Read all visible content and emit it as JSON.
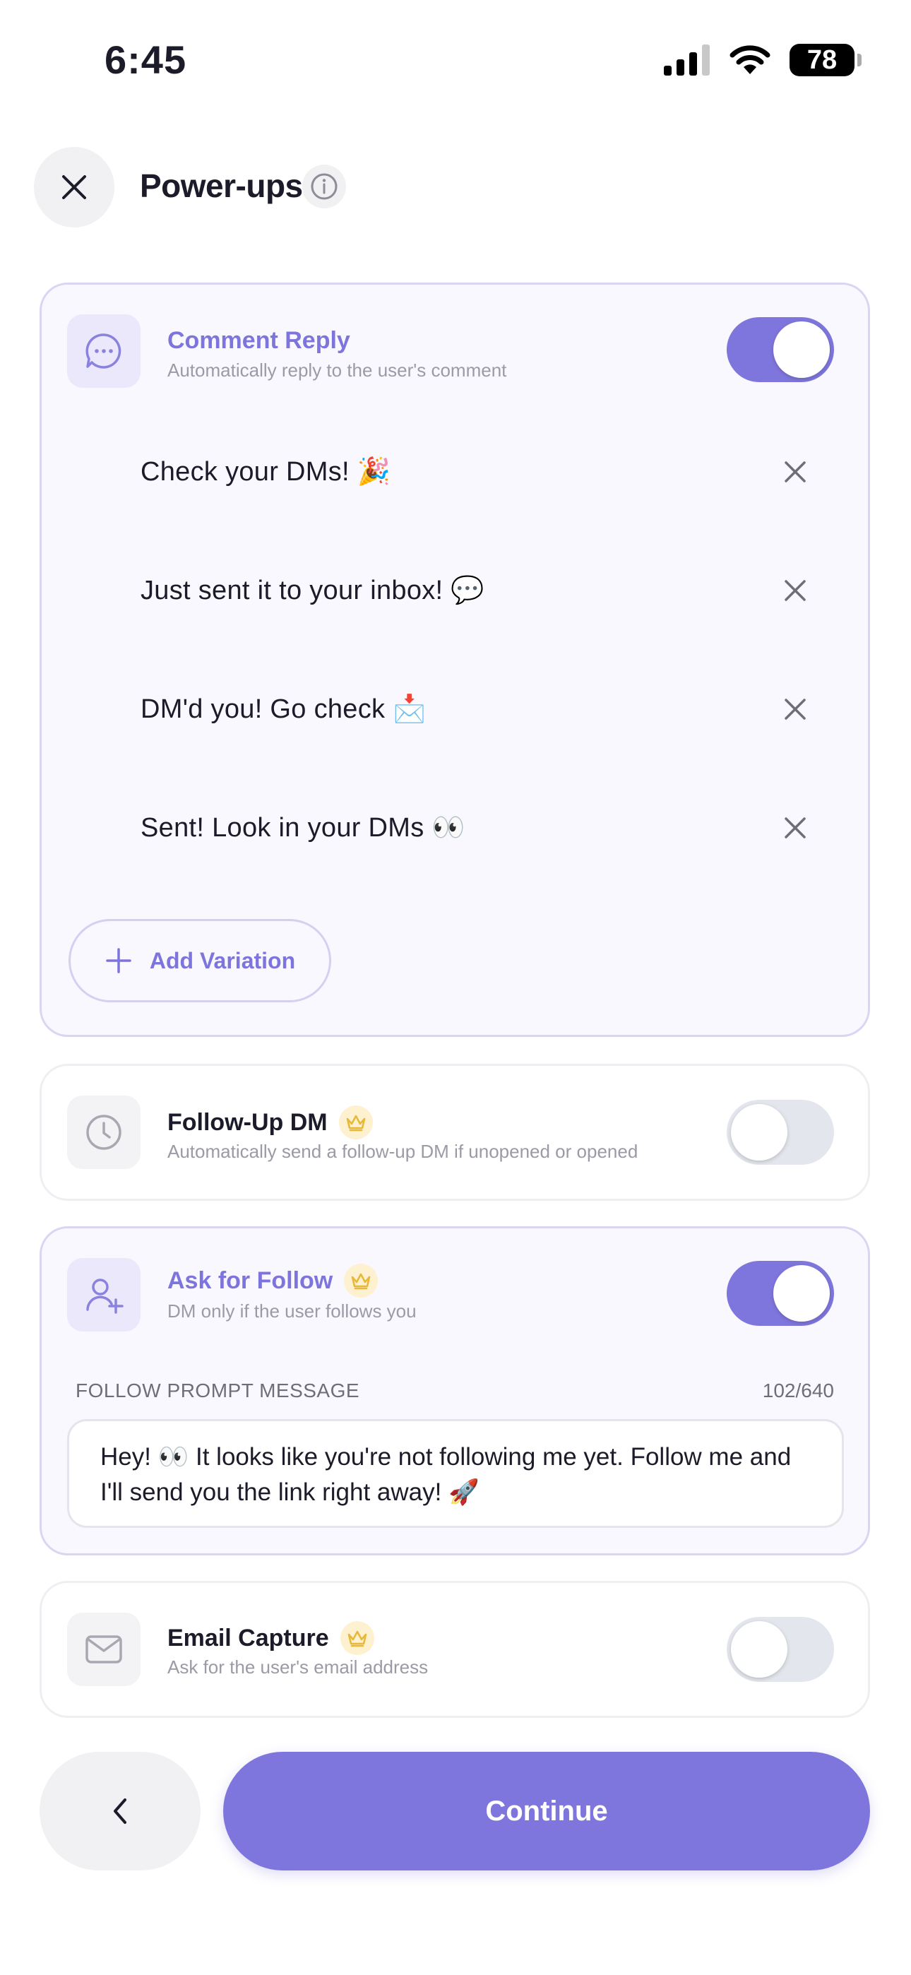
{
  "status_bar": {
    "time": "6:45",
    "battery": "78"
  },
  "header": {
    "title": "Power-ups"
  },
  "comment_reply": {
    "title": "Comment Reply",
    "subtitle": "Automatically reply to the user's comment",
    "enabled": true,
    "variations": [
      "Check your DMs! 🎉",
      "Just sent it to your inbox! 💬",
      "DM'd you! Go check 📩",
      "Sent! Look in your DMs 👀"
    ],
    "add_label": "Add Variation"
  },
  "follow_up_dm": {
    "title": "Follow-Up DM",
    "subtitle": "Automatically send a follow-up DM if unopened or opened",
    "enabled": false
  },
  "ask_for_follow": {
    "title": "Ask for Follow",
    "subtitle": "DM only if the user follows you",
    "enabled": true,
    "prompt_label": "FOLLOW PROMPT MESSAGE",
    "prompt_count": "102/640",
    "prompt_text": "Hey! 👀 It looks like you're not following me yet. Follow me and I'll send you the link right away! 🚀"
  },
  "email_capture": {
    "title": "Email Capture",
    "subtitle": "Ask for the user's email address",
    "enabled": false
  },
  "footer": {
    "continue_label": "Continue"
  },
  "colors": {
    "accent": "#7f76dd",
    "crown": "#e8b83a"
  }
}
